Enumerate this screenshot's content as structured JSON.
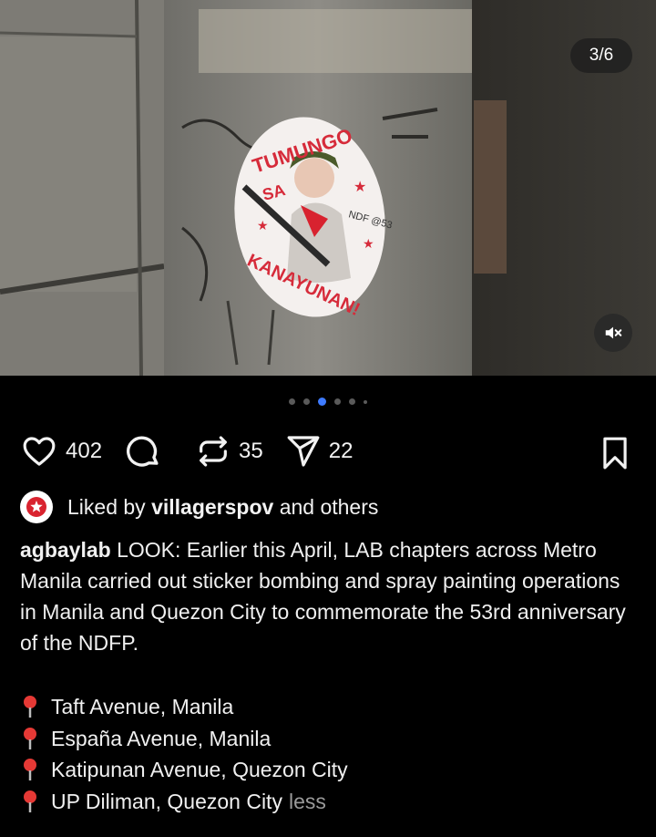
{
  "post": {
    "counter": "3/6",
    "sticker": {
      "top_text": "TUMUNGO",
      "mid_text": "SA",
      "bottom_text": "KANAYUNAN!",
      "badge": "NDF @53"
    },
    "carousel": {
      "total": 6,
      "active_index": 3
    }
  },
  "actions": {
    "likes": "402",
    "reposts": "35",
    "shares": "22"
  },
  "liked_by": {
    "prefix": "Liked by",
    "user": "villagerspov",
    "suffix": "and others"
  },
  "caption": {
    "username": "agbaylab",
    "text": "LOOK: Earlier this April, LAB chapters across Metro Manila carried out sticker bombing and spray painting operations in Manila and Quezon City to commemorate the 53rd anniversary of the NDFP."
  },
  "locations": [
    "Taft Avenue, Manila",
    "España Avenue, Manila",
    "Katipunan Avenue, Quezon City",
    "UP Diliman, Quezon City"
  ],
  "less_label": "less",
  "colors": {
    "accent": "#3e7bff",
    "pin": "#e53935",
    "background": "#000000"
  }
}
